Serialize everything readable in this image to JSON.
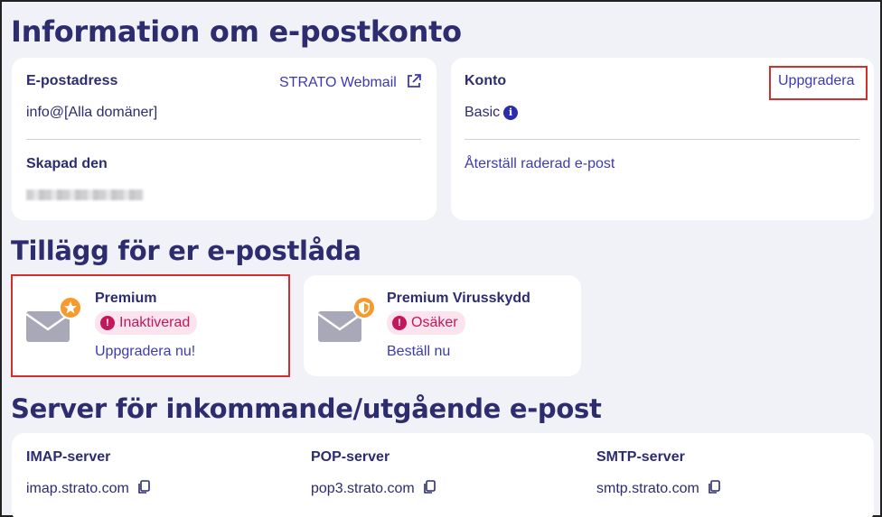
{
  "section1": {
    "title": "Information om e-postkonto",
    "email_card": {
      "label": "E-postadress",
      "webmail_link": "STRATO Webmail",
      "value": "info@[Alla domäner]",
      "created_label": "Skapad den"
    },
    "account_card": {
      "label": "Konto",
      "upgrade_link": "Uppgradera",
      "plan": "Basic",
      "restore_link": "Återställ raderad e-post"
    }
  },
  "section2": {
    "title": "Tillägg för er e-postlåda",
    "addons": [
      {
        "name": "Premium",
        "status": "Inaktiverad",
        "action": "Uppgradera nu!",
        "icon": "star-icon"
      },
      {
        "name": "Premium Virusskydd",
        "status": "Osäker",
        "action": "Beställ nu",
        "icon": "shield-icon"
      }
    ]
  },
  "section3": {
    "title": "Server för inkommande/utgående e-post",
    "servers": [
      {
        "label": "IMAP-server",
        "host": "imap.strato.com"
      },
      {
        "label": "POP-server",
        "host": "pop3.strato.com"
      },
      {
        "label": "SMTP-server",
        "host": "smtp.strato.com"
      }
    ]
  },
  "colors": {
    "navy": "#2d2c6e",
    "link": "#3d3ab0",
    "alert": "#c2185b",
    "highlight": "#d32f2f",
    "accent": "#f79a2b"
  }
}
